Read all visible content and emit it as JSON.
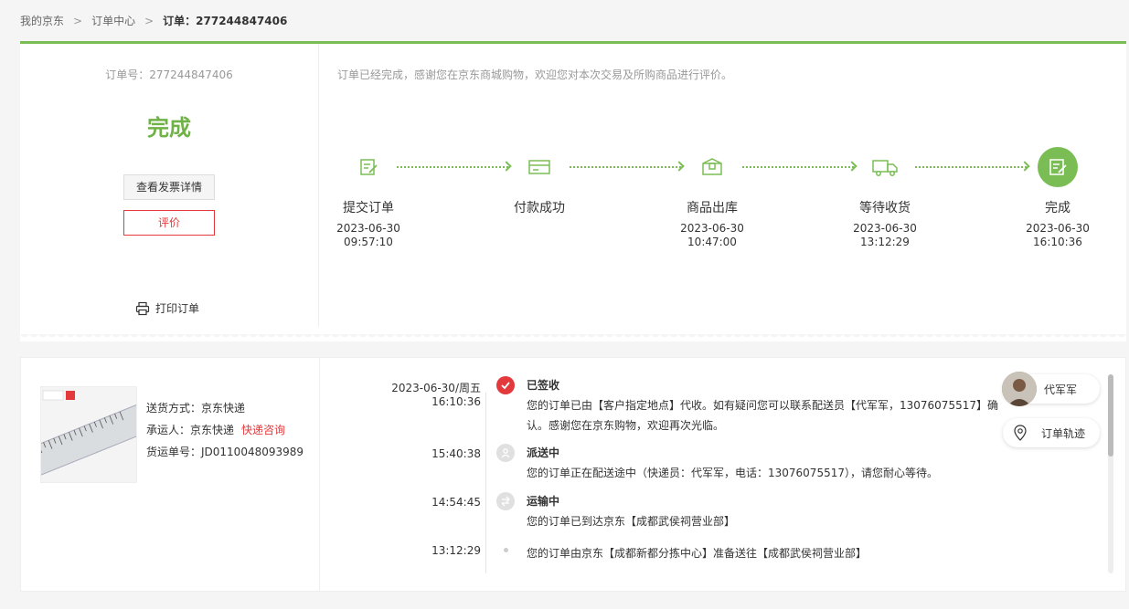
{
  "breadcrumb": {
    "home": "我的京东",
    "orders": "订单中心",
    "current": "订单：277244847406"
  },
  "order": {
    "order_no": "订单号：277244847406",
    "status": "完成",
    "invoice_btn": "查看发票详情",
    "review_btn": "评价",
    "print": "打印订单",
    "notice": "订单已经完成，感谢您在京东商城购物，欢迎您对本次交易及所购商品进行评价。"
  },
  "steps": [
    {
      "label": "提交订单",
      "date": "2023-06-30",
      "time": "09:57:10",
      "icon": "edit-icon"
    },
    {
      "label": "付款成功",
      "date": "",
      "time": "",
      "icon": "card-icon"
    },
    {
      "label": "商品出库",
      "date": "2023-06-30",
      "time": "10:47:00",
      "icon": "package-icon"
    },
    {
      "label": "等待收货",
      "date": "2023-06-30",
      "time": "13:12:29",
      "icon": "truck-icon"
    },
    {
      "label": "完成",
      "date": "2023-06-30",
      "time": "16:10:36",
      "icon": "done-icon"
    }
  ],
  "shipping": {
    "method": "送货方式：京东快递",
    "carrier": "承运人：京东快递",
    "consult": "快递咨询",
    "tracking_no": "货运单号：JD0110048093989"
  },
  "tracking": [
    {
      "date": "2023-06-30/周五  16:10:36",
      "title": "已签收",
      "desc": "您的订单已由【客户指定地点】代收。如有疑问您可以联系配送员【代军军，13076075517】确认。感谢您在京东购物，欢迎再次光临。"
    },
    {
      "date": "15:40:38",
      "title": "派送中",
      "desc": "您的订单正在配送途中（快递员：代军军，电话：13076075517），请您耐心等待。"
    },
    {
      "date": "14:54:45",
      "title": "运输中",
      "desc": "您的订单已到达京东【成都武侯祠营业部】"
    },
    {
      "date": "13:12:29",
      "title": "",
      "desc": "您的订单由京东【成都新都分拣中心】准备送往【成都武侯祠营业部】"
    }
  ],
  "courier": {
    "name": "代军军",
    "track_btn": "订单轨迹"
  },
  "colors": {
    "green": "#7abd54",
    "red": "#e4393c"
  }
}
